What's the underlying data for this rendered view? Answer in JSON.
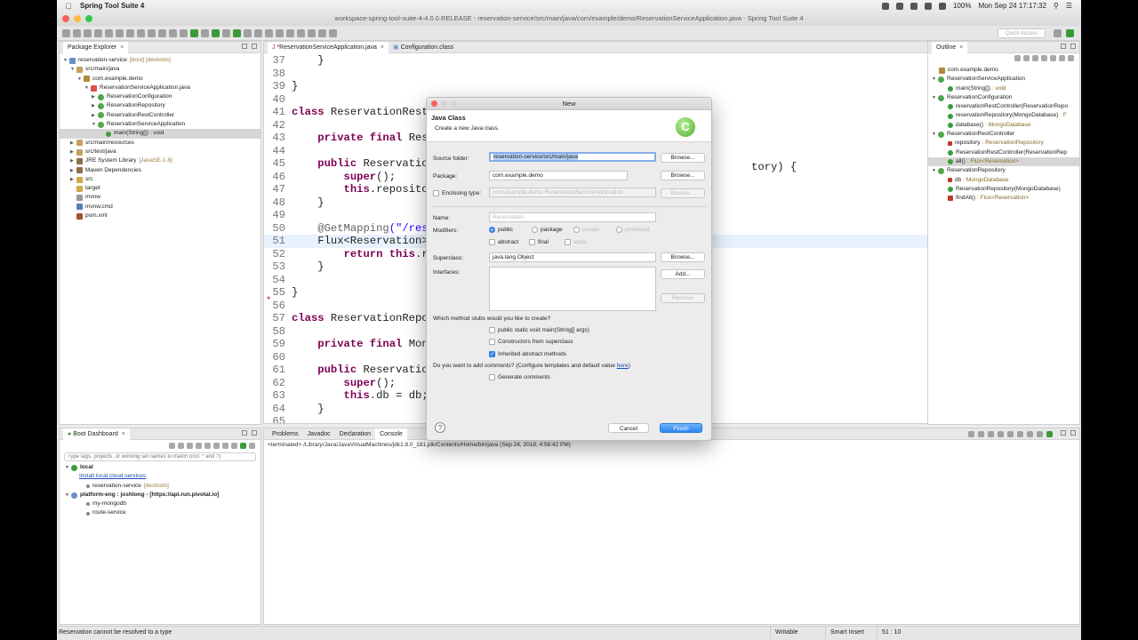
{
  "menubar": {
    "app_name": "Spring Tool Suite 4",
    "battery": "100%",
    "datetime": "Mon Sep 24  17:17:32"
  },
  "window": {
    "title": "workspace-spring-tool-suite-4-4.0.0.RELEASE - reservation-service/src/main/java/com/example/demo/ReservationServiceApplication.java - Spring Tool Suite 4"
  },
  "toolbar": {
    "quick_access": "Quick Access"
  },
  "package_explorer": {
    "tab": "Package Explorer",
    "items": [
      {
        "label": "reservation-service",
        "deco": "[boot] [devtools]"
      },
      {
        "label": "src/main/java"
      },
      {
        "label": "com.example.demo"
      },
      {
        "label": "ReservationServiceApplication.java"
      },
      {
        "label": "ReservationConfiguration"
      },
      {
        "label": "ReservationRepository"
      },
      {
        "label": "ReservationRestController"
      },
      {
        "label": "ReservationServiceApplication"
      },
      {
        "label": "main(String[]) : void"
      },
      {
        "label": "src/main/resources"
      },
      {
        "label": "src/test/java"
      },
      {
        "label": "JRE System Library",
        "deco": "[JavaSE-1.8]"
      },
      {
        "label": "Maven Dependencies"
      },
      {
        "label": "src"
      },
      {
        "label": "target"
      },
      {
        "label": "mvnw"
      },
      {
        "label": "mvnw.cmd"
      },
      {
        "label": "pom.xml"
      }
    ]
  },
  "editor": {
    "tabs": [
      {
        "label": "*ReservationServiceApplication.java"
      },
      {
        "label": "Configuration.class"
      }
    ],
    "lines": [
      {
        "n": "37",
        "code": "    }"
      },
      {
        "n": "38",
        "code": ""
      },
      {
        "n": "39",
        "code": "}"
      },
      {
        "n": "40",
        "code": ""
      },
      {
        "n": "41",
        "code": "class ReservationRest"
      },
      {
        "n": "42",
        "code": ""
      },
      {
        "n": "43",
        "code": "    private final Res"
      },
      {
        "n": "44",
        "code": ""
      },
      {
        "n": "45",
        "code": "    public Reservatio"
      },
      {
        "n": "46",
        "code": "        super();"
      },
      {
        "n": "47",
        "code": "        this.reposito"
      },
      {
        "n": "48",
        "code": "    }"
      },
      {
        "n": "49",
        "code": ""
      },
      {
        "n": "50",
        "code": "    @GetMapping(\"/res"
      },
      {
        "n": "51",
        "code": "    Flux<Reservation>"
      },
      {
        "n": "52",
        "code": "        return this.r"
      },
      {
        "n": "53",
        "code": "    }"
      },
      {
        "n": "54",
        "code": ""
      },
      {
        "n": "55",
        "code": "}"
      },
      {
        "n": "56",
        "code": ""
      },
      {
        "n": "57",
        "code": "class ReservationRepo"
      },
      {
        "n": "58",
        "code": ""
      },
      {
        "n": "59",
        "code": "    private final Mon"
      },
      {
        "n": "60",
        "code": ""
      },
      {
        "n": "61",
        "code": "    public Reservatio"
      },
      {
        "n": "62",
        "code": "        super();"
      },
      {
        "n": "63",
        "code": "        this.db = db;"
      },
      {
        "n": "64",
        "code": "    }"
      },
      {
        "n": "65",
        "code": ""
      }
    ],
    "line45_tail": "tory) {"
  },
  "outline": {
    "tab": "Outline",
    "items": [
      {
        "label": "com.example.demo"
      },
      {
        "label": "ReservationServiceApplication"
      },
      {
        "label": "main(String[])",
        "deco": ": void"
      },
      {
        "label": "ReservationConfiguration"
      },
      {
        "label": "reservationRestController(ReservationRepo"
      },
      {
        "label": "reservationRepository(MongoDatabase)",
        "deco": ": F"
      },
      {
        "label": "database()",
        "deco": ": MongoDatabase"
      },
      {
        "label": "ReservationRestController"
      },
      {
        "label": "repository",
        "deco": ": ReservationRepository"
      },
      {
        "label": "ReservationRestController(ReservationRep"
      },
      {
        "label": "all()",
        "deco": ": Flux<Reservation>"
      },
      {
        "label": "ReservationRepository"
      },
      {
        "label": "db",
        "deco": ": MongoDatabase"
      },
      {
        "label": "ReservationRepository(MongoDatabase)"
      },
      {
        "label": "findAll()",
        "deco": ": Flux<Reservation>"
      }
    ]
  },
  "boot_dashboard": {
    "tab": "Boot Dashboard",
    "filter_placeholder": "Type tags, projects, or working set names to match (incl. * and ?)",
    "items": [
      {
        "label": "local"
      },
      {
        "label": "Install local cloud services"
      },
      {
        "label": "reservation-service",
        "deco": "[devtools]"
      },
      {
        "label": "platform-eng : joshlong - [https://api.run.pivotal.io]"
      },
      {
        "label": "my-mongodb"
      },
      {
        "label": "route-service"
      }
    ]
  },
  "console": {
    "tabs": [
      "Problems",
      "Javadoc",
      "Declaration",
      "Console"
    ],
    "path": "<terminated> /Library/Java/JavaVirtualMachines/jdk1.8.0_181.jdk/Contents/Home/bin/java (Sep 24, 2018, 4:56:42 PM)"
  },
  "dialog": {
    "title": "New",
    "header_title": "Java Class",
    "header_subtitle": "Create a new Java class.",
    "logo": "C",
    "source_folder_label": "Source folder:",
    "source_folder_value": "reservation-service/src/main/java",
    "package_label": "Package:",
    "package_value": "com.example.demo",
    "enclosing_label": "Enclosing type:",
    "enclosing_value": "com.example.demo.ReservationServiceApplication",
    "name_label": "Name:",
    "name_value": "Reservation",
    "modifiers_label": "Modifiers:",
    "mod_public": "public",
    "mod_package": "package",
    "mod_private": "private",
    "mod_protected": "protected",
    "mod_abstract": "abstract",
    "mod_final": "final",
    "mod_static": "static",
    "superclass_label": "Superclass:",
    "superclass_value": "java.lang.Object",
    "interfaces_label": "Interfaces:",
    "browse": "Browse...",
    "add": "Add...",
    "remove": "Remove",
    "stubs_question": "Which method stubs would you like to create?",
    "stub_main": "public static void main(String[] args)",
    "stub_constructors": "Constructors from superclass",
    "stub_inherited": "Inherited abstract methods",
    "comments_question": "Do you want to add comments? (Configure templates and default value ",
    "comments_link": "here",
    "comments_close": ")",
    "generate_comments": "Generate comments",
    "help": "?",
    "cancel": "Cancel",
    "finish": "Finish"
  },
  "statusbar": {
    "message": "Reservation cannot be resolved to a type",
    "writable": "Writable",
    "insert": "Smart Insert",
    "position": "51 : 10"
  }
}
